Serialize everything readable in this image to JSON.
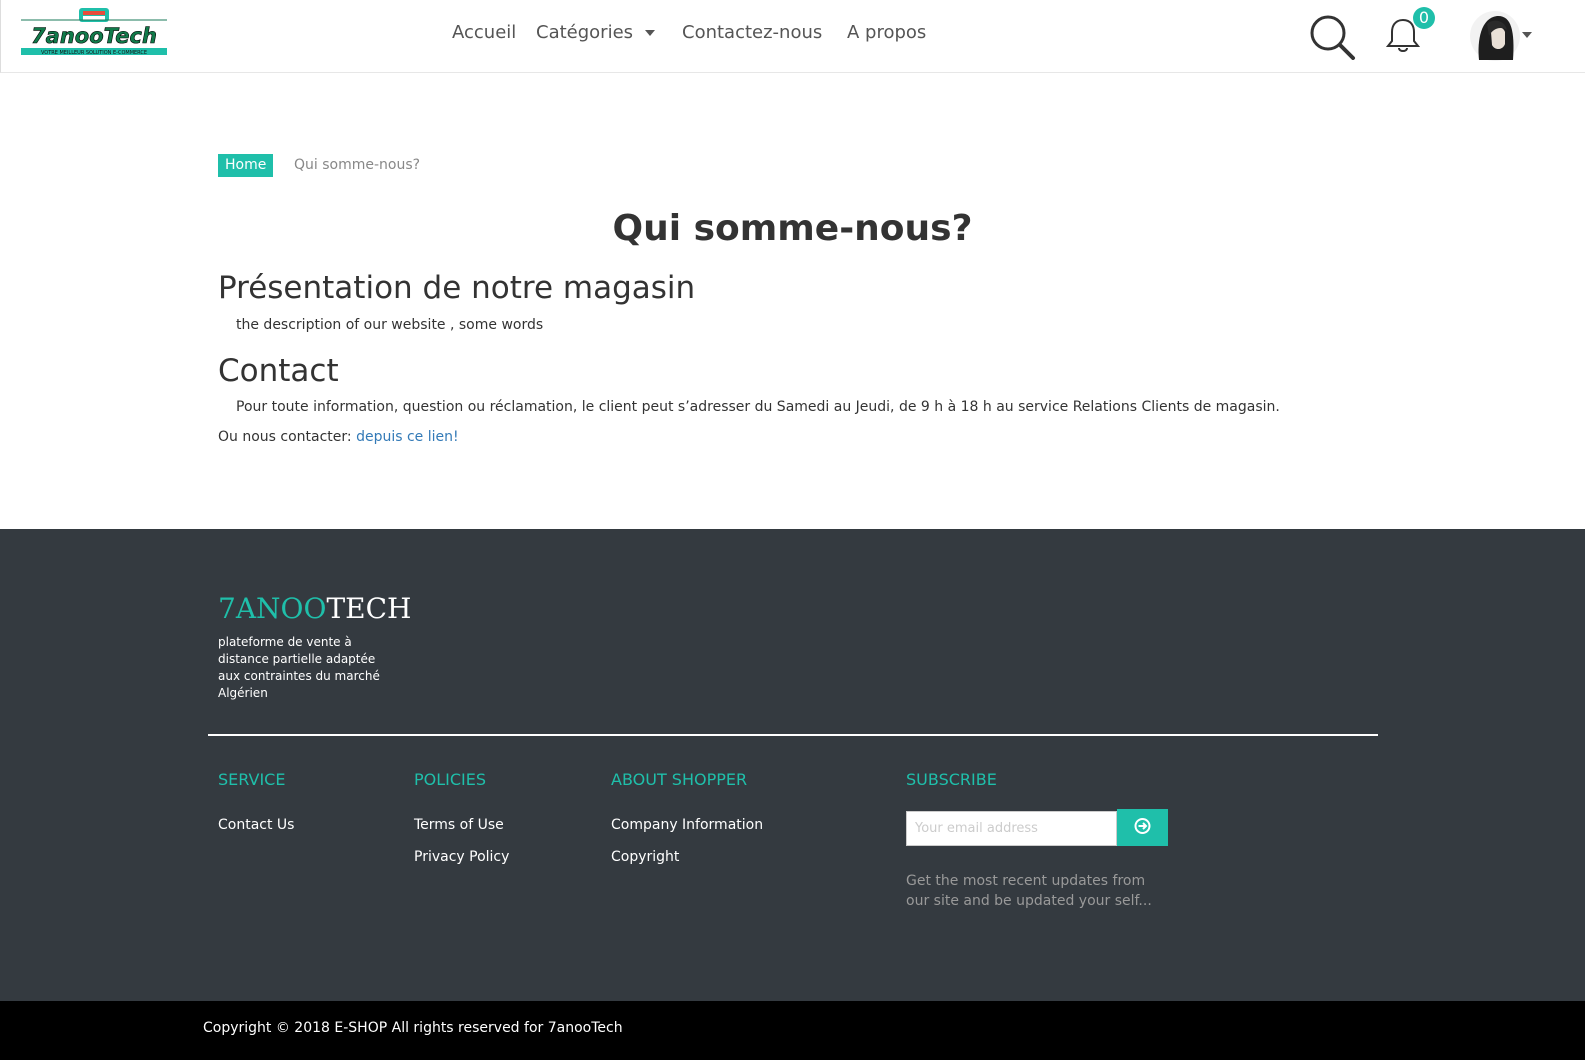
{
  "nav": {
    "logo_text": "7anooTech",
    "logo_tagline": "VOTRE MEILLEUR SOLUTION E-COMMERCE",
    "items": [
      "Accueil",
      "Catégories",
      "Contactez-nous",
      "A propos"
    ],
    "notification_count": "0",
    "icons": [
      "search-icon",
      "bell-icon",
      "avatar"
    ]
  },
  "breadcrumb": {
    "home": "Home",
    "current": "Qui somme-nous?"
  },
  "main": {
    "title": "Qui somme-nous?",
    "presentation_heading": "Présentation de notre magasin",
    "presentation_text": "the description of our website , some words",
    "contact_heading": "Contact",
    "contact_text": "Pour toute information, question ou réclamation, le client peut s’adresser du Samedi au Jeudi, de 9 h à 18 h au service Relations Clients de magasin.",
    "contact_link_prefix": "Ou nous contacter: ",
    "contact_link": "depuis ce lien!"
  },
  "footer": {
    "brand_part1": "7ANOO",
    "brand_part2": "TECH",
    "brand_description": "plateforme de vente à distance partielle adaptée aux contraintes du marché Algérien",
    "columns": {
      "service": {
        "title": "SERVICE",
        "links": [
          "Contact Us"
        ]
      },
      "policies": {
        "title": "POLICIES",
        "links": [
          "Terms of Use",
          "Privacy Policy"
        ]
      },
      "about": {
        "title": "ABOUT SHOPPER",
        "links": [
          "Company Information",
          "Copyright"
        ]
      },
      "subscribe": {
        "title": "SUBSCRIBE",
        "placeholder": "Your email address",
        "note": "Get the most recent updates from our site and be updated your self..."
      }
    },
    "copyright": "Copyright © 2018 E-SHOP All rights reserved for 7anooTech"
  },
  "colors": {
    "accent": "#1fbfaa",
    "footer_bg": "#343a40",
    "copyright_bg": "#000000",
    "link": "#337ab7"
  }
}
